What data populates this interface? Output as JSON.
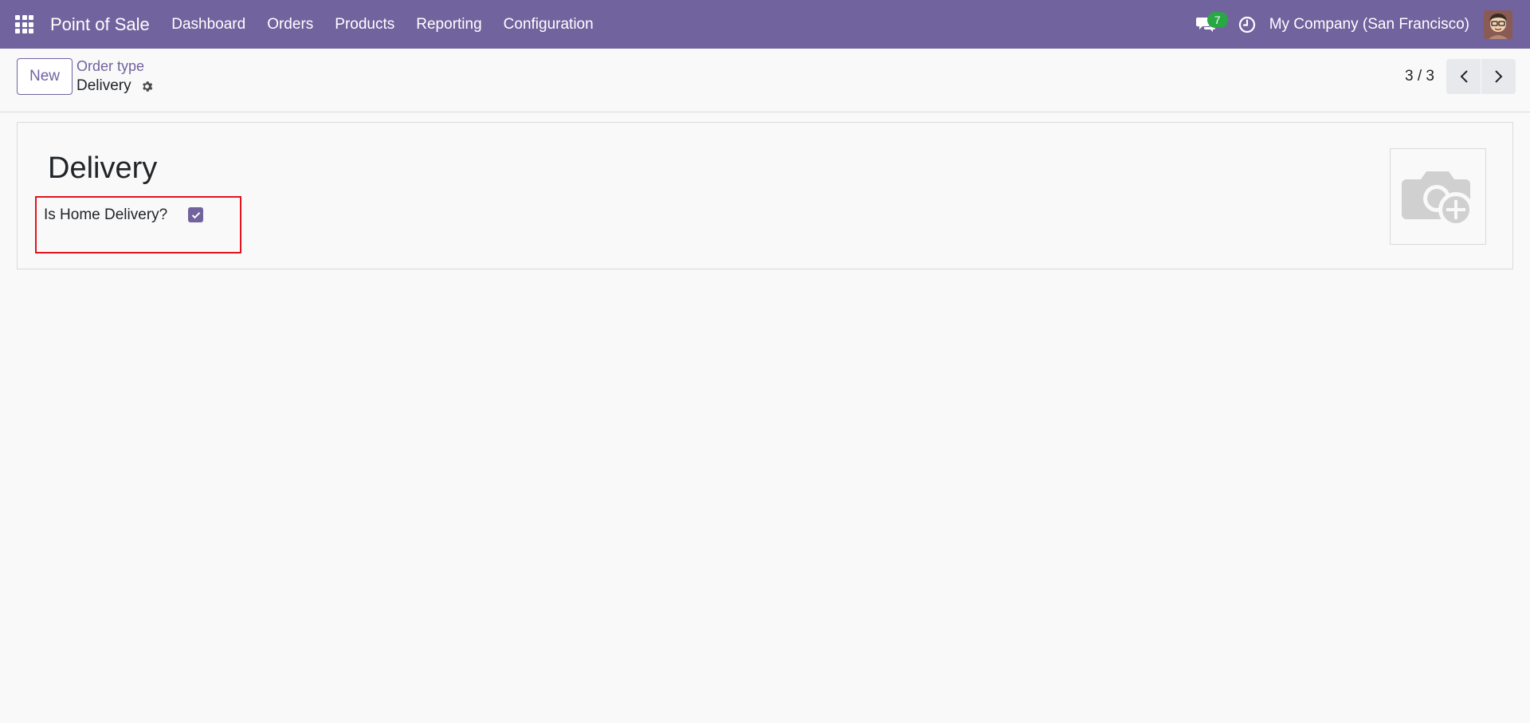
{
  "navbar": {
    "app_title": "Point of Sale",
    "menu": [
      "Dashboard",
      "Orders",
      "Products",
      "Reporting",
      "Configuration"
    ],
    "messages_count": "7",
    "company": "My Company (San Francisco)",
    "accent_color": "#71639e",
    "badge_color": "#28a745"
  },
  "control_panel": {
    "new_label": "New",
    "breadcrumb_parent": "Order type",
    "breadcrumb_current": "Delivery",
    "pager": "3 / 3"
  },
  "form": {
    "title": "Delivery",
    "field_label": "Is Home Delivery?",
    "field_checked": true,
    "highlight_color": "#e3141d"
  },
  "icons": [
    "apps-grid-icon",
    "chat-icon",
    "clock-icon",
    "user-avatar",
    "gear-icon",
    "chevron-left-icon",
    "chevron-right-icon",
    "camera-plus-icon",
    "check-icon"
  ]
}
